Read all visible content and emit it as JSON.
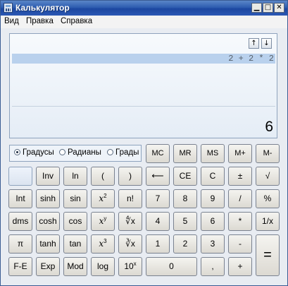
{
  "titlebar": {
    "title": "Калькулятор",
    "min_glyph": "▁",
    "max_glyph": "□",
    "close_glyph": "✕"
  },
  "menu": {
    "items": [
      "Вид",
      "Правка",
      "Справка"
    ]
  },
  "display": {
    "history_up": "↑",
    "history_down": "↓",
    "expression": "2 + 2 * 2",
    "result": "6"
  },
  "angle_units": {
    "options": [
      "Градусы",
      "Радианы",
      "Грады"
    ],
    "selected": "Градусы"
  },
  "memory_keys": [
    "MC",
    "MR",
    "MS",
    "M+",
    "M-"
  ],
  "keys": {
    "inv": "Inv",
    "ln": "ln",
    "lparen": "(",
    "rparen": ")",
    "backspace": "⟵",
    "ce": "CE",
    "c": "C",
    "plusminus": "±",
    "sqrt": "√",
    "int": "Int",
    "sinh": "sinh",
    "sin": "sin",
    "x2_base": "x",
    "x2_exp": "2",
    "factorial": "n!",
    "d7": "7",
    "d8": "8",
    "d9": "9",
    "div": "/",
    "percent": "%",
    "dms": "dms",
    "cosh": "cosh",
    "cos": "cos",
    "xy_base": "x",
    "xy_exp": "y",
    "yroot": "∜x",
    "d4": "4",
    "d5": "5",
    "d6": "6",
    "mul": "*",
    "recip": "1/x",
    "pi": "π",
    "tanh": "tanh",
    "tan": "tan",
    "x3_base": "x",
    "x3_exp": "3",
    "croot": "∛x",
    "d1": "1",
    "d2": "2",
    "d3": "3",
    "minus": "-",
    "equals": "=",
    "fe": "F-E",
    "exp": "Exp",
    "mod": "Mod",
    "log": "log",
    "tenx_base": "10",
    "tenx_exp": "x",
    "d0": "0",
    "dot": ",",
    "plus": "+"
  }
}
